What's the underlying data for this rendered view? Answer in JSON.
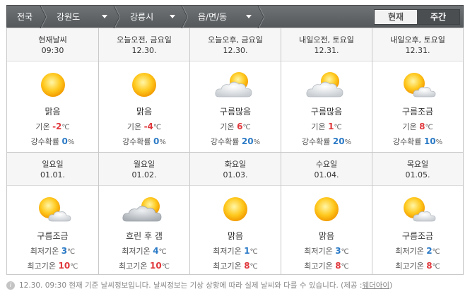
{
  "nav": {
    "crumbs": [
      "전국",
      "강원도",
      "강릉시",
      "읍/면/동"
    ],
    "toggle_now": "현재",
    "toggle_week": "주간"
  },
  "days": [
    {
      "title": "현재날씨",
      "sub": "09:30",
      "icon": "sun-icon",
      "cond": "맑음",
      "l1_label": "기온",
      "l1_value": "-2",
      "l1_unit": "℃",
      "l2_label": "강수확률",
      "l2_value": "0",
      "l2_unit": "%"
    },
    {
      "title": "오늘오전, 금요일",
      "sub": "12.30.",
      "icon": "sun-icon",
      "cond": "맑음",
      "l1_label": "기온",
      "l1_value": "-4",
      "l1_unit": "℃",
      "l2_label": "강수확률",
      "l2_value": "0",
      "l2_unit": "%"
    },
    {
      "title": "오늘오후, 금요일",
      "sub": "12.30.",
      "icon": "sun-cloud-icon",
      "cond": "구름많음",
      "l1_label": "기온",
      "l1_value": "6",
      "l1_unit": "℃",
      "l2_label": "강수확률",
      "l2_value": "20",
      "l2_unit": "%"
    },
    {
      "title": "내일오전, 토요일",
      "sub": "12.31.",
      "icon": "sun-cloud-icon",
      "cond": "구름많음",
      "l1_label": "기온",
      "l1_value": "1",
      "l1_unit": "℃",
      "l2_label": "강수확률",
      "l2_value": "20",
      "l2_unit": "%"
    },
    {
      "title": "내일오후, 토요일",
      "sub": "12.31.",
      "icon": "sun-small-cloud-icon",
      "cond": "구름조금",
      "l1_label": "기온",
      "l1_value": "8",
      "l1_unit": "℃",
      "l2_label": "강수확률",
      "l2_value": "10",
      "l2_unit": "%"
    },
    {
      "title": "일요일",
      "sub": "01.01.",
      "icon": "sun-small-cloud-icon",
      "cond": "구름조금",
      "l1_label": "최저기온",
      "l1_value": "3",
      "l1_unit": "℃",
      "l2_label": "최고기온",
      "l2_value": "10",
      "l2_unit": "℃"
    },
    {
      "title": "월요일",
      "sub": "01.02.",
      "icon": "cloudy-clearing-icon",
      "cond": "흐린 후 갬",
      "l1_label": "최저기온",
      "l1_value": "4",
      "l1_unit": "℃",
      "l2_label": "최고기온",
      "l2_value": "10",
      "l2_unit": "℃"
    },
    {
      "title": "화요일",
      "sub": "01.03.",
      "icon": "sun-icon",
      "cond": "맑음",
      "l1_label": "최저기온",
      "l1_value": "1",
      "l1_unit": "℃",
      "l2_label": "최고기온",
      "l2_value": "8",
      "l2_unit": "℃"
    },
    {
      "title": "수요일",
      "sub": "01.04.",
      "icon": "sun-icon",
      "cond": "맑음",
      "l1_label": "최저기온",
      "l1_value": "3",
      "l1_unit": "℃",
      "l2_label": "최고기온",
      "l2_value": "8",
      "l2_unit": "℃"
    },
    {
      "title": "목요일",
      "sub": "01.05.",
      "icon": "sun-small-cloud-icon",
      "cond": "구름조금",
      "l1_label": "최저기온",
      "l1_value": "2",
      "l1_unit": "℃",
      "l2_label": "최고기온",
      "l2_value": "8",
      "l2_unit": "℃"
    }
  ],
  "footer": {
    "text": "12.30.  09:30 현재 기준 날씨정보입니다. 날씨정보는 기상 상황에 따라 실제 날씨와 다를 수 있습니다. (제공 : ",
    "link": "웨더아이",
    "end": ")"
  },
  "colors": {
    "accent_red": "#e0383c",
    "accent_blue": "#2b7ac6",
    "bar": "#5d6164"
  }
}
